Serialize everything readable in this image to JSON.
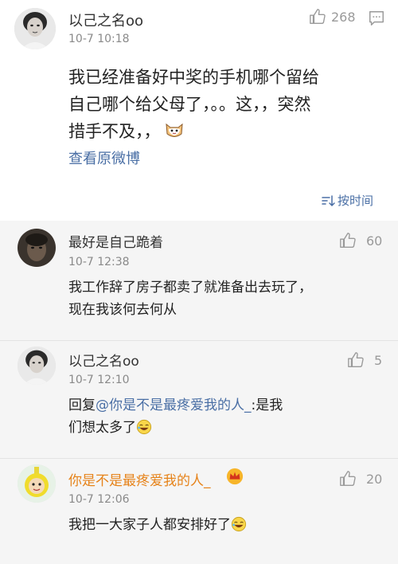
{
  "post": {
    "username": "以己之名oo",
    "timestamp": "10-7 10:18",
    "like_count": "268",
    "content_lines": [
      "我已经准备好中奖的手机哪个留给",
      "自己哪个给父母了，。。这，，突然",
      "措手不及，，"
    ],
    "view_original": "查看原微博",
    "sort_label": "按时间"
  },
  "replies": [
    {
      "username": "最好是自己跪着",
      "timestamp": "10-7 12:38",
      "like_count": "60",
      "content_lines": [
        "我工作辞了房子都卖了就准备出去玩了，",
        "现在我该何去何从"
      ]
    },
    {
      "username": "以己之名oo",
      "timestamp": "10-7 12:10",
      "like_count": "5",
      "reply_prefix": "回复",
      "mention": "@你是不是最疼爱我的人_",
      "content_after_mention": ":是我",
      "content_line2": "们想太多了"
    },
    {
      "username": "你是不是最疼爱我的人_",
      "timestamp": "10-7 12:06",
      "like_count": "20",
      "content_lines": [
        "我把一大家子人都安排好了"
      ]
    }
  ],
  "colors": {
    "link": "#4a6fa5",
    "username_highlight": "#e6831a",
    "muted": "#8a8a8a",
    "reply_bg": "#f5f5f5"
  },
  "icons": [
    "thumbs-up-icon",
    "comment-icon",
    "sort-icon",
    "cat-emoji-icon",
    "laughing-emoji-icon",
    "crown-badge-icon"
  ]
}
